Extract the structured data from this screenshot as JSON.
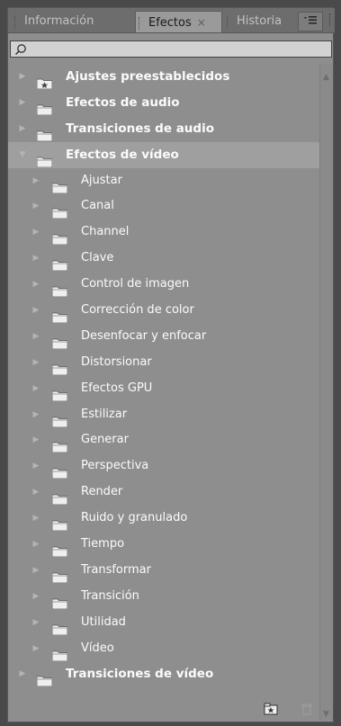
{
  "tabs": [
    {
      "label": "Información"
    },
    {
      "label": "Efectos",
      "close": "×"
    },
    {
      "label": "Historia"
    }
  ],
  "panel_menu_icon": "panel-menu-icon",
  "search": {
    "value": "",
    "icon": "search-icon"
  },
  "tree": [
    {
      "label": "Ajustes preestablecidos",
      "level": 0,
      "expanded": false,
      "icon": "preset-folder-icon"
    },
    {
      "label": "Efectos de audio",
      "level": 0,
      "expanded": false,
      "icon": "folder-icon"
    },
    {
      "label": "Transiciones de audio",
      "level": 0,
      "expanded": false,
      "icon": "folder-icon"
    },
    {
      "label": "Efectos de vídeo",
      "level": 0,
      "expanded": true,
      "selected": true,
      "icon": "folder-icon"
    },
    {
      "label": "Ajustar",
      "level": 1,
      "expanded": false,
      "icon": "folder-icon"
    },
    {
      "label": "Canal",
      "level": 1,
      "expanded": false,
      "icon": "folder-icon"
    },
    {
      "label": "Channel",
      "level": 1,
      "expanded": false,
      "icon": "folder-icon"
    },
    {
      "label": "Clave",
      "level": 1,
      "expanded": false,
      "icon": "folder-icon"
    },
    {
      "label": "Control de imagen",
      "level": 1,
      "expanded": false,
      "icon": "folder-icon"
    },
    {
      "label": "Corrección de color",
      "level": 1,
      "expanded": false,
      "icon": "folder-icon"
    },
    {
      "label": "Desenfocar y enfocar",
      "level": 1,
      "expanded": false,
      "icon": "folder-icon"
    },
    {
      "label": "Distorsionar",
      "level": 1,
      "expanded": false,
      "icon": "folder-icon"
    },
    {
      "label": "Efectos GPU",
      "level": 1,
      "expanded": false,
      "icon": "folder-icon"
    },
    {
      "label": "Estilizar",
      "level": 1,
      "expanded": false,
      "icon": "folder-icon"
    },
    {
      "label": "Generar",
      "level": 1,
      "expanded": false,
      "icon": "folder-icon"
    },
    {
      "label": "Perspectiva",
      "level": 1,
      "expanded": false,
      "icon": "folder-icon"
    },
    {
      "label": "Render",
      "level": 1,
      "expanded": false,
      "icon": "folder-icon"
    },
    {
      "label": "Ruido y granulado",
      "level": 1,
      "expanded": false,
      "icon": "folder-icon"
    },
    {
      "label": "Tiempo",
      "level": 1,
      "expanded": false,
      "icon": "folder-icon"
    },
    {
      "label": "Transformar",
      "level": 1,
      "expanded": false,
      "icon": "folder-icon"
    },
    {
      "label": "Transición",
      "level": 1,
      "expanded": false,
      "icon": "folder-icon"
    },
    {
      "label": "Utilidad",
      "level": 1,
      "expanded": false,
      "icon": "folder-icon"
    },
    {
      "label": "Vídeo",
      "level": 1,
      "expanded": false,
      "icon": "folder-icon"
    },
    {
      "label": "Transiciones de vídeo",
      "level": 0,
      "expanded": false,
      "icon": "folder-icon"
    }
  ],
  "footer": {
    "new_bin_icon": "new-custom-bin-icon",
    "delete_icon": "trash-icon"
  },
  "colors": {
    "panel_bg": "#8e8e8e",
    "selected_row": "#9f9f9f",
    "text": "#fbfbfb"
  }
}
